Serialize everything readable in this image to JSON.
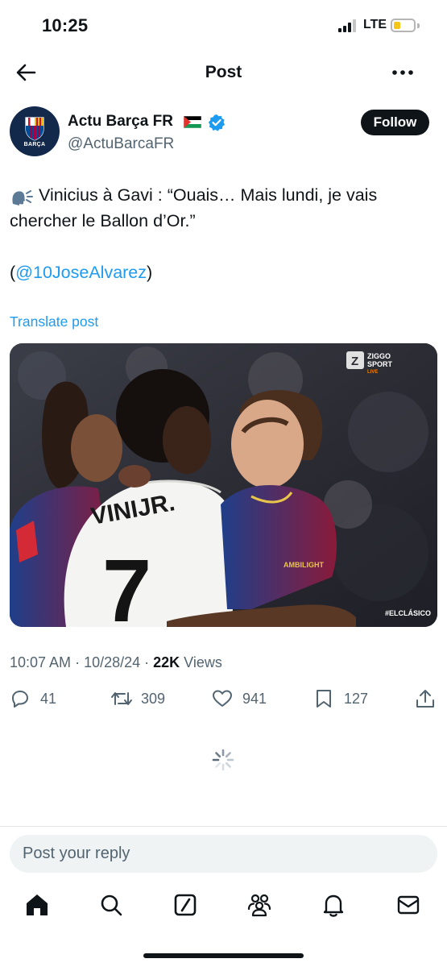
{
  "status_bar": {
    "time": "10:25",
    "network": "LTE",
    "battery_level": 0.3,
    "battery_color": "#f5c518"
  },
  "header": {
    "title": "Post",
    "back_icon": "arrow-left-icon",
    "more_icon": "more-horizontal-icon"
  },
  "author": {
    "name": "Actu Barça FR",
    "handle": "@ActuBarcaFR",
    "avatar_text": "BARÇA",
    "flag_icon": "palestine-flag-icon",
    "verified_icon": "verified-badge-icon",
    "follow_label": "Follow"
  },
  "tweet": {
    "line1": "Vinicius à Gavi : “Ouais… Mais lundi, je vais",
    "line2": "chercher le Ballon d’Or.”",
    "mention_open": "(",
    "mention": "@10JoseAlvarez",
    "mention_close": ")",
    "translate_label": "Translate post",
    "leading_icon": "speaking-head-icon"
  },
  "media": {
    "broadcaster_line1": "ZIGGO",
    "broadcaster_line2": "SPORT",
    "broadcaster_line3": "LIVE",
    "hashtag": "#ELCLÁSICO",
    "jersey_name": "VINIJR.",
    "jersey_number": "7",
    "sponsor": "AMBILIGHT"
  },
  "meta": {
    "time": "10:07 AM",
    "sep1": " · ",
    "date": "10/28/24",
    "sep2": " · ",
    "views_count": "22K",
    "views_label": " Views"
  },
  "actions": {
    "replies": "41",
    "reposts": "309",
    "likes": "941",
    "bookmarks": "127"
  },
  "reply": {
    "placeholder": "Post your reply"
  },
  "tabs": [
    "home-icon",
    "search-icon",
    "grok-icon",
    "communities-icon",
    "notifications-icon",
    "messages-icon"
  ],
  "colors": {
    "accent": "#1d9bf0",
    "text": "#0f1419",
    "secondary": "#536471"
  }
}
